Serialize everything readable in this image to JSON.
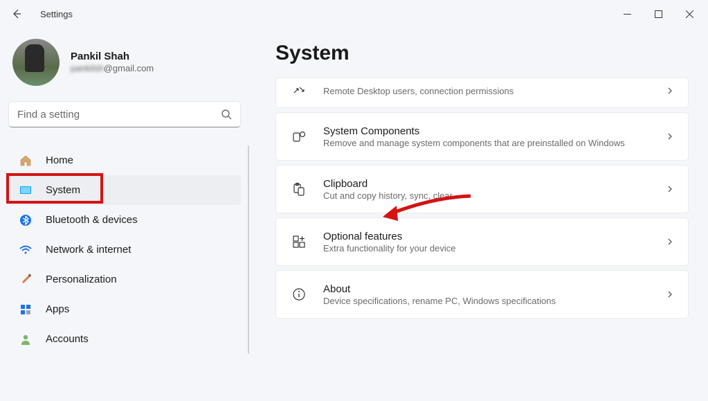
{
  "titlebar": {
    "title": "Settings"
  },
  "profile": {
    "name": "Pankil Shah",
    "email_blurred": "pankilsh",
    "email_suffix": "@gmail.com"
  },
  "search": {
    "placeholder": "Find a setting"
  },
  "nav": {
    "items": [
      {
        "label": "Home"
      },
      {
        "label": "System"
      },
      {
        "label": "Bluetooth & devices"
      },
      {
        "label": "Network & internet"
      },
      {
        "label": "Personalization"
      },
      {
        "label": "Apps"
      },
      {
        "label": "Accounts"
      }
    ],
    "active_index": 1,
    "highlighted_index": 1
  },
  "page": {
    "title": "System"
  },
  "cards": [
    {
      "title_visible": false,
      "subtitle": "Remote Desktop users, connection permissions",
      "icon": "remote-desktop"
    },
    {
      "title": "System Components",
      "subtitle": "Remove and manage system components that are preinstalled on Windows",
      "icon": "components"
    },
    {
      "title": "Clipboard",
      "subtitle": "Cut and copy history, sync, clear",
      "icon": "clipboard"
    },
    {
      "title": "Optional features",
      "subtitle": "Extra functionality for your device",
      "icon": "optional"
    },
    {
      "title": "About",
      "subtitle": "Device specifications, rename PC, Windows specifications",
      "icon": "about"
    }
  ]
}
